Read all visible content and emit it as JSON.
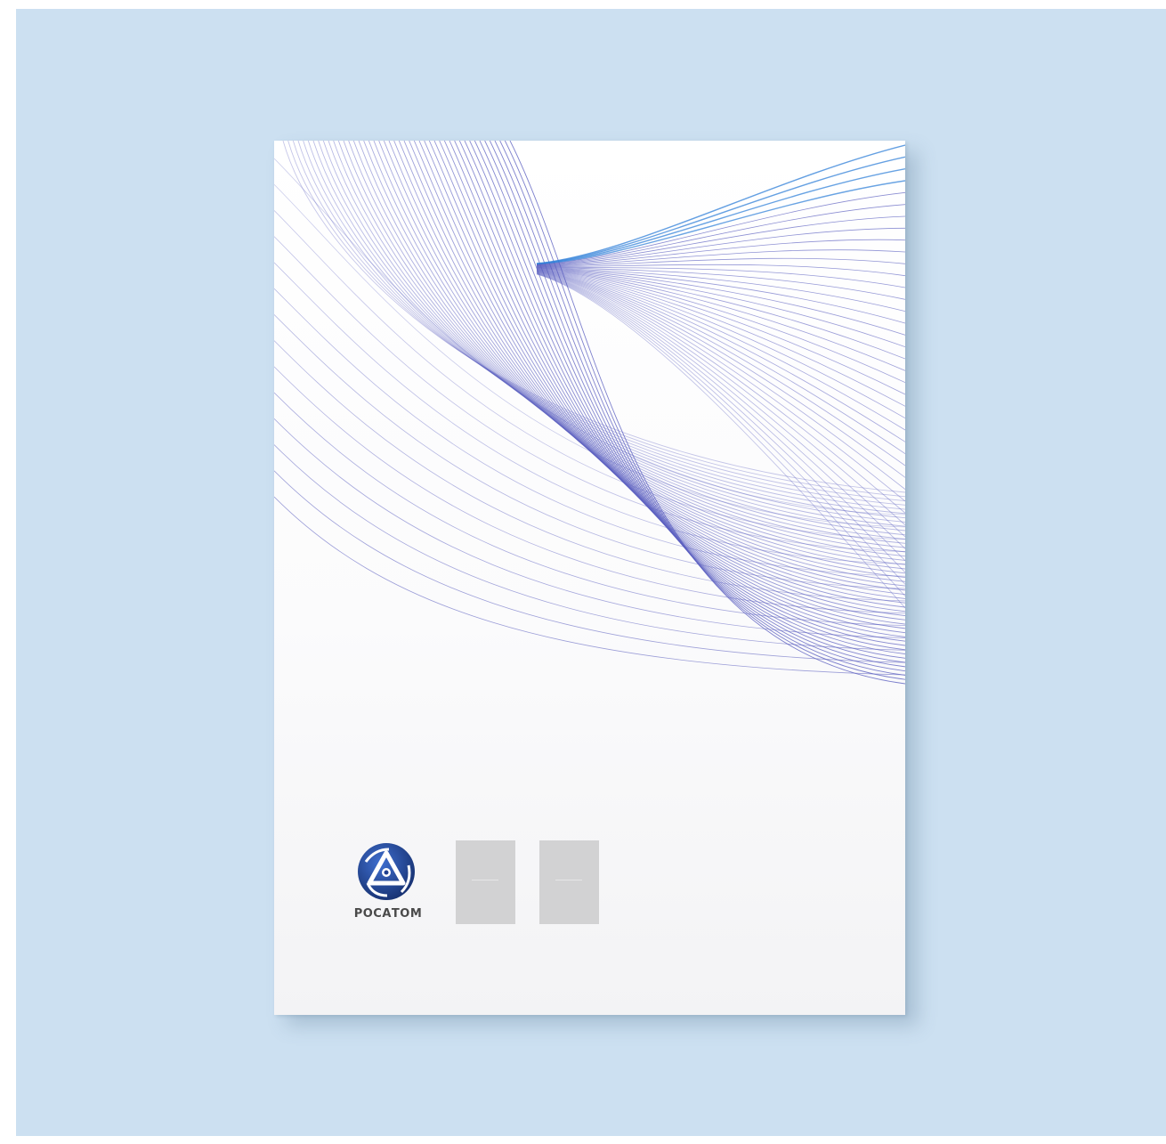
{
  "colors": {
    "backdrop": "#cce0f1",
    "cover": "#ffffff",
    "line_primary": "#5b5fc0",
    "line_accent": "#2f7fd8",
    "logo_blue": "#1f3f8f",
    "placeholder": "#d2d2d3"
  },
  "cover": {
    "logo": {
      "wordmark": "РОСАТОМ",
      "icon": "rosatom-emblem-icon"
    },
    "placeholders": [
      {
        "name": "logo-placeholder-1"
      },
      {
        "name": "logo-placeholder-2"
      }
    ]
  }
}
